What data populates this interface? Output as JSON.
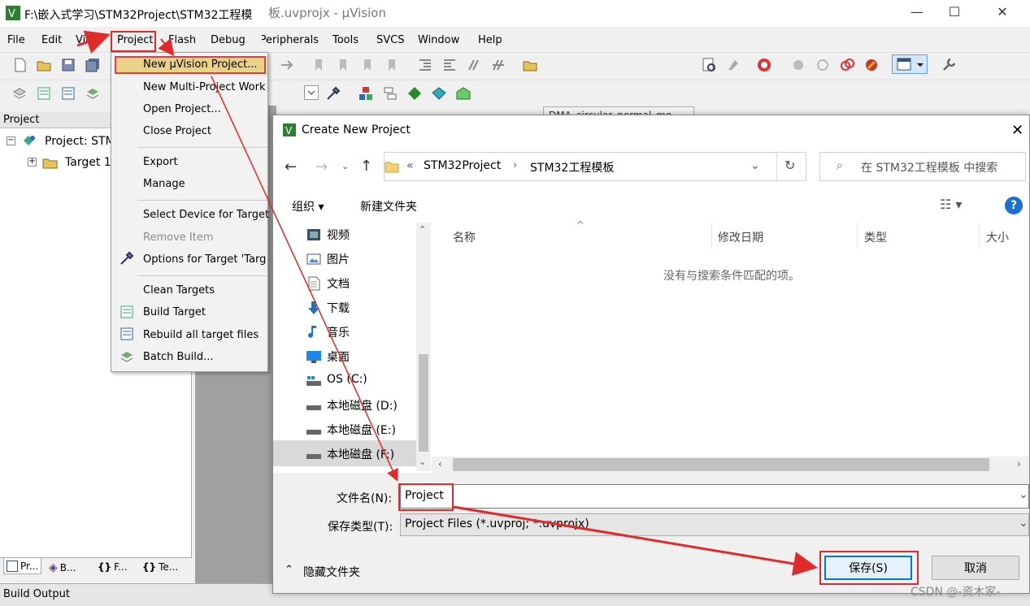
{
  "main_window": {
    "title": "F:\\嵌入式学习\\STM32Project\\STM32工程模",
    "title_suffix": "板.uvprojx - µVision",
    "menu": [
      "File",
      "Edit",
      "View",
      "Project",
      "Flash",
      "Debug",
      "Peripherals",
      "Tools",
      "SVCS",
      "Window",
      "Help"
    ],
    "target_combo": "DMA_circular_normal_mo"
  },
  "project_panel": {
    "header": "Project",
    "root": "Project: STM",
    "target": "Target 1",
    "tabs": [
      "Pr...",
      "B...",
      "F...",
      "Te..."
    ]
  },
  "build_output": "Build Output",
  "project_menu": {
    "items": [
      "New µVision Project...",
      "New Multi-Project Work",
      "Open Project...",
      "Close Project",
      "Export",
      "Manage",
      "Select Device for Target '",
      "Remove Item",
      "Options for Target 'Targ",
      "Clean Targets",
      "Build Target",
      "Rebuild all target files",
      "Batch Build..."
    ]
  },
  "dialog": {
    "title": "Create New Project",
    "breadcrumb_prefix": "«",
    "breadcrumb": [
      "STM32Project",
      "STM32工程模板"
    ],
    "search_placeholder": "在 STM32工程模板 中搜索",
    "organize": "组织 ▾",
    "new_folder": "新建文件夹",
    "nav_items": [
      "视频",
      "图片",
      "文档",
      "下载",
      "音乐",
      "桌面",
      "OS (C:)",
      "本地磁盘 (D:)",
      "本地磁盘 (E:)",
      "本地磁盘 (F:)"
    ],
    "columns": [
      "名称",
      "修改日期",
      "类型",
      "大小"
    ],
    "empty_message": "没有与搜索条件匹配的项。",
    "filename_label": "文件名(N):",
    "filename_value": "Project",
    "filetype_label": "保存类型(T):",
    "filetype_value": "Project Files (*.uvproj; *.uvprojx)",
    "hide_folders": "隐藏文件夹",
    "save_button": "保存(S)",
    "cancel_button": "取消"
  },
  "watermark": "CSDN @-资木家-"
}
